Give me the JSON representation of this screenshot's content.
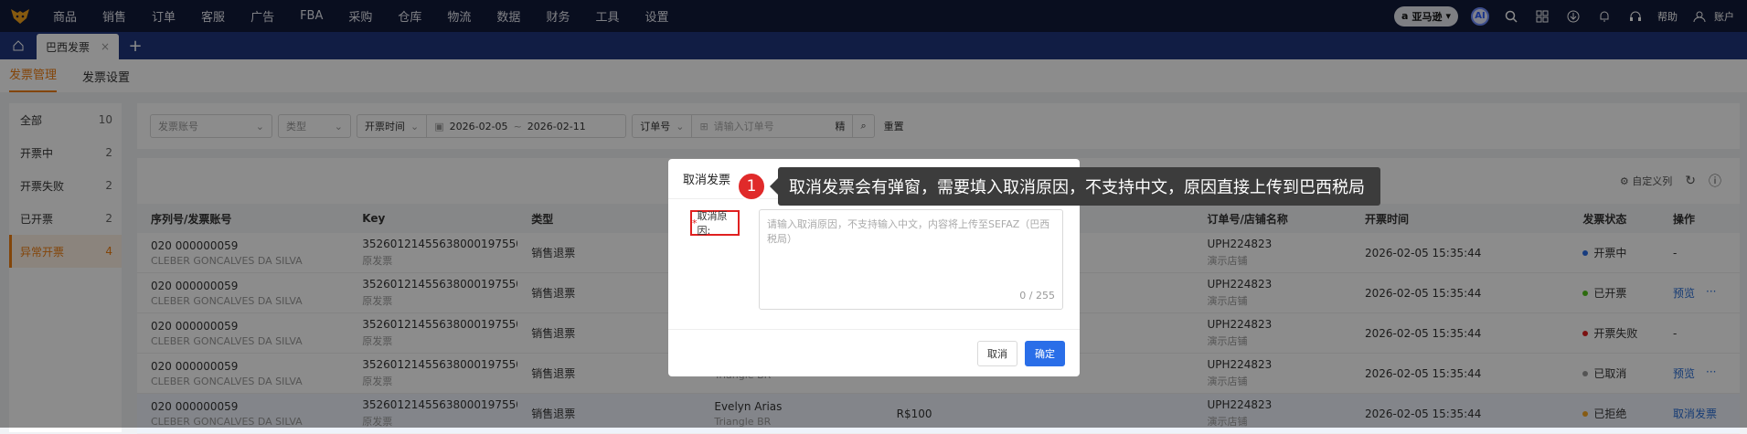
{
  "topnav": {
    "menu": [
      "商品",
      "销售",
      "订单",
      "客服",
      "广告",
      "FBA",
      "采购",
      "仓库",
      "物流",
      "数据",
      "财务",
      "工具",
      "设置"
    ],
    "platform": "亚马逊",
    "ai_label": "AI",
    "help": "帮助",
    "account": "账户"
  },
  "tabs": {
    "active": "巴西发票",
    "add": "+"
  },
  "subnav": {
    "items": [
      "发票管理",
      "发票设置"
    ]
  },
  "sidebar": {
    "items": [
      {
        "label": "全部",
        "count": "10"
      },
      {
        "label": "开票中",
        "count": "2"
      },
      {
        "label": "开票失败",
        "count": "2"
      },
      {
        "label": "已开票",
        "count": "2"
      },
      {
        "label": "异常开票",
        "count": "4"
      }
    ]
  },
  "filters": {
    "account_placeholder": "发票账号",
    "type_placeholder": "类型",
    "time_field": "开票时间",
    "date_start": "2026-02-05",
    "date_sep": "~",
    "date_end": "2026-02-11",
    "order_field": "订单号",
    "order_placeholder": "请输入订单号",
    "exact": "精",
    "reset": "重置"
  },
  "toolbar": {
    "custom_cols": "自定义列"
  },
  "table": {
    "headers": [
      "序列号/发票账号",
      "Key",
      "类型",
      "",
      "",
      "订单号/店铺名称",
      "开票时间",
      "发票状态",
      "操作"
    ],
    "rows": [
      {
        "serial": "020 000000059",
        "account": "CLEBER GONCALVES DA SILVA",
        "key": "352601214556380001975500200...",
        "key_sub": "原发票",
        "type": "销售退票",
        "name": "",
        "name_sub": "",
        "amount": "",
        "order": "UPH224823",
        "store": "演示店铺",
        "time": "2026-02-05 15:35:44",
        "status": "开票中",
        "status_color": "#2a6ee8",
        "action": "-",
        "action_more": ""
      },
      {
        "serial": "020 000000059",
        "account": "CLEBER GONCALVES DA SILVA",
        "key": "352601214556380001975500200...",
        "key_sub": "原发票",
        "type": "销售退票",
        "name": "",
        "name_sub": "",
        "amount": "",
        "order": "UPH224823",
        "store": "演示店铺",
        "time": "2026-02-05 15:35:44",
        "status": "已开票",
        "status_color": "#52c41a",
        "action": "预览",
        "action_more": "···"
      },
      {
        "serial": "020 000000059",
        "account": "CLEBER GONCALVES DA SILVA",
        "key": "352601214556380001975500200...",
        "key_sub": "原发票",
        "type": "销售退票",
        "name": "",
        "name_sub": "",
        "amount": "",
        "order": "UPH224823",
        "store": "演示店铺",
        "time": "2026-02-05 15:35:44",
        "status": "开票失败",
        "status_color": "#e02020",
        "action": "-",
        "action_more": ""
      },
      {
        "serial": "020 000000059",
        "account": "CLEBER GONCALVES DA SILVA",
        "key": "352601214556380001975500200...",
        "key_sub": "原发票",
        "type": "销售退票",
        "name": "",
        "name_sub": "Triangle BR",
        "amount": "",
        "order": "UPH224823",
        "store": "演示店铺",
        "time": "2026-02-05 15:35:44",
        "status": "已取消",
        "status_color": "#999999",
        "action": "预览",
        "action_more": "···"
      },
      {
        "serial": "020 000000059",
        "account": "CLEBER GONCALVES DA SILVA",
        "key": "352601214556380001975500200...",
        "key_sub": "原发票",
        "type": "销售退票",
        "name": "Evelyn Arias",
        "name_sub": "Triangle BR",
        "amount": "R$100",
        "order": "UPH224823",
        "store": "演示店铺",
        "time": "2026-02-05 15:35:44",
        "status": "已拒绝",
        "status_color": "#f5a623",
        "action": "取消发票",
        "action_more": ""
      }
    ]
  },
  "modal": {
    "title": "取消发票",
    "required_mark": "*",
    "label": "取消原因:",
    "placeholder": "请输入取消原因，不支持输入中文，内容将上传至SEFAZ（巴西税局）",
    "counter": "0 / 255",
    "cancel": "取消",
    "confirm": "确定"
  },
  "annotation": {
    "number": "1",
    "text": "取消发票会有弹窗，需要填入取消原因，不支持中文，原因直接上传到巴西税局"
  }
}
